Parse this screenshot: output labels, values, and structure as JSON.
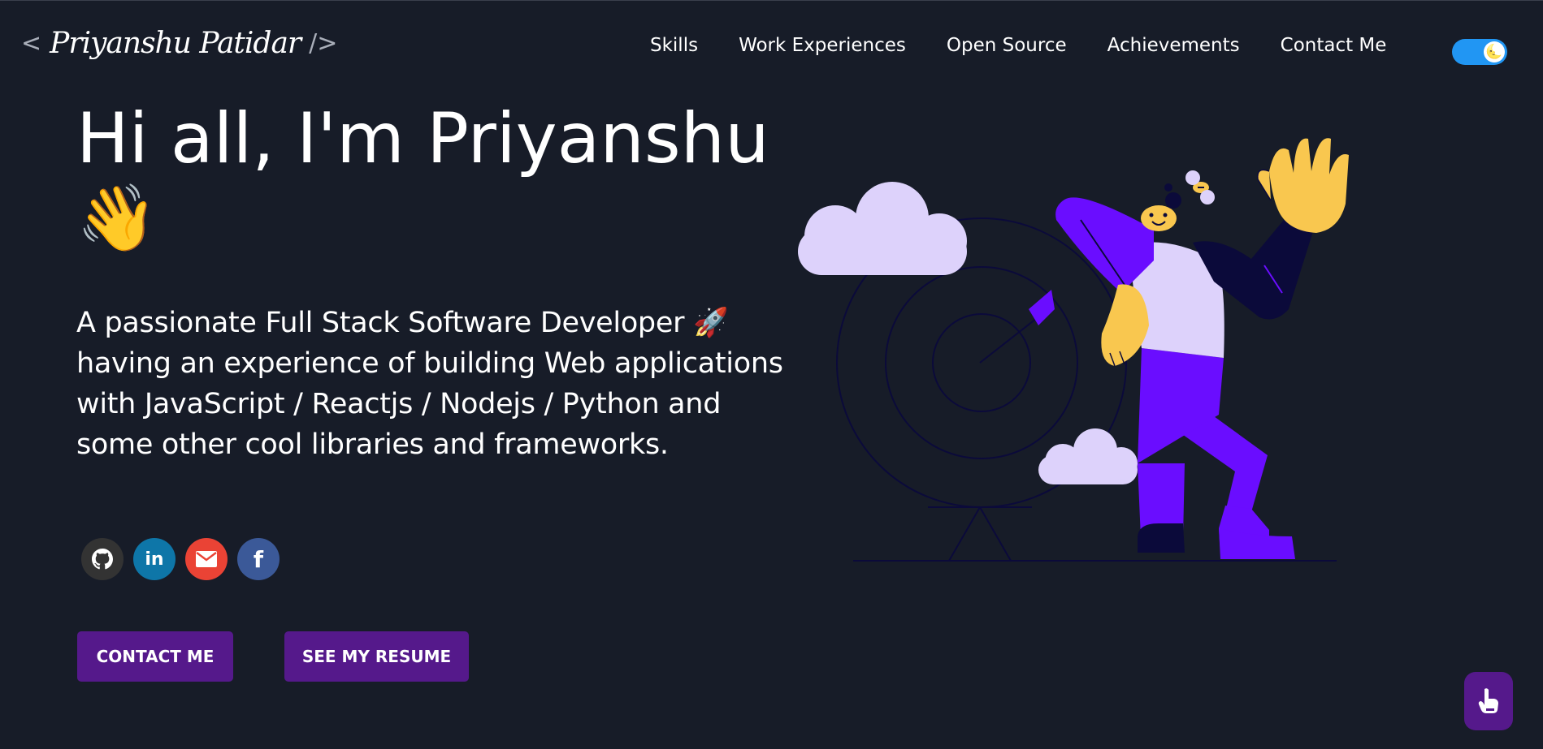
{
  "header": {
    "logo": {
      "open_bracket": "<",
      "name": "Priyanshu Patidar",
      "close_bracket": "/>"
    },
    "nav": [
      {
        "label": "Skills"
      },
      {
        "label": "Work Experiences"
      },
      {
        "label": "Open Source"
      },
      {
        "label": "Achievements"
      },
      {
        "label": "Contact Me"
      }
    ],
    "theme_toggle": {
      "state": "on",
      "icon": "moon-emoji",
      "icon_glyph": "🌜",
      "color": "#2196f3"
    }
  },
  "hero": {
    "title": "Hi all, I'm Priyanshu",
    "wave_emoji": "👋",
    "subtitle": "A passionate Full Stack Software Developer 🚀 having an experience of building Web applications with JavaScript / Reactjs / Nodejs / Python and some other cool libraries and frameworks.",
    "socials": [
      {
        "name": "github",
        "icon": "github-icon",
        "color": "#333333"
      },
      {
        "name": "linkedin",
        "icon": "linkedin-icon",
        "glyph": "in",
        "color": "#0e76a8"
      },
      {
        "name": "gmail",
        "icon": "envelope-icon",
        "color": "#ea4335"
      },
      {
        "name": "facebook",
        "icon": "facebook-icon",
        "glyph": "f",
        "color": "#3b5998"
      }
    ],
    "buttons": {
      "contact": "CONTACT ME",
      "resume": "SEE MY RESUME"
    }
  },
  "colors": {
    "background": "#171c28",
    "accent": "#55198b",
    "illustration_purple": "#6a0dff",
    "illustration_lavender": "#ddd2fb",
    "illustration_yellow": "#f9c74f"
  },
  "floating_button": {
    "icon": "pointing-hand-icon"
  }
}
